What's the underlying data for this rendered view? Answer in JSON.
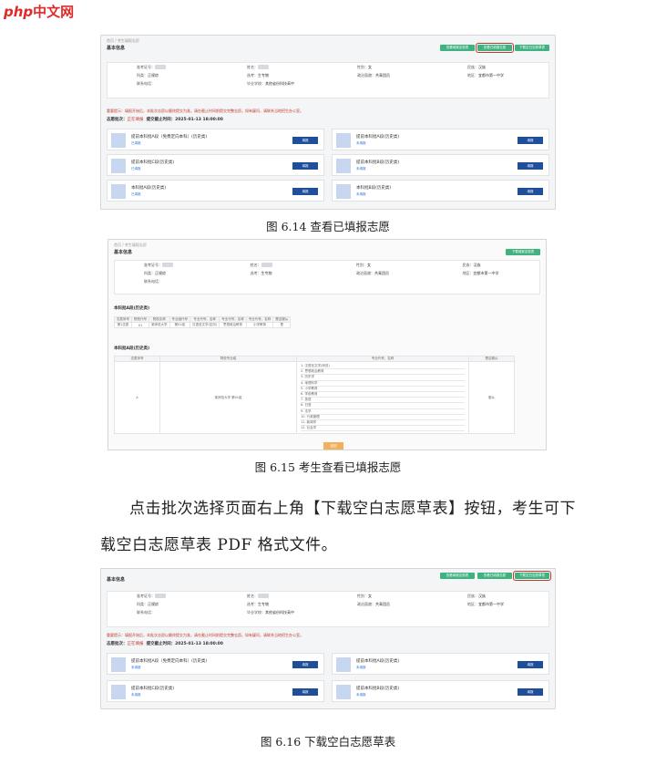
{
  "logo": {
    "php": "php",
    "cn": "中文网"
  },
  "common": {
    "crumb": "首页  /  考生填报志愿",
    "section_title": "基本信息",
    "labels": {
      "exam_no": "准考证号：",
      "name": "姓名：",
      "gender": "性别：",
      "nation": "民族：",
      "category": "科类：",
      "subject": "选考：",
      "political": "政治面貌：",
      "region": "地区：",
      "school": "毕业学校：",
      "phone": "联系电话："
    },
    "values": {
      "category": "正规综",
      "subject": "生专物",
      "gender": "女",
      "nation": "汉族",
      "political": "共青团员",
      "region": "宜都市第一中学",
      "school": "其他省份科技高中"
    },
    "top_buttons": [
      "查看填报志愿表",
      "查看已填报志愿",
      "下载空白志愿草表"
    ],
    "notice": "重要提示：填报开始后，本批次志愿以最终提交为准，请在截止时间前提交完整志愿。如有疑问，请联系当地招生办公室。",
    "batch": "志愿批次：",
    "batch_status": "正在填报",
    "deadline": "提交截止时间：2025-01-13 18:00:00",
    "card_button": "填报"
  },
  "figure1": {
    "caption": "图 6.14  查看已填报志愿",
    "cards": [
      {
        "name": "提前本科批A段（免费定向本科）(历史类)",
        "status": "已填报"
      },
      {
        "name": "提前本科批A段(历史类)",
        "status": "未填报"
      },
      {
        "name": "提前本科批C段(历史类)",
        "status": "已填报"
      },
      {
        "name": "提前本科批B段(历史类)",
        "status": "未填报"
      },
      {
        "name": "本科批A段(历史类)",
        "status": "已填报"
      },
      {
        "name": "本科批B段(历史类)",
        "status": "未填报"
      }
    ]
  },
  "figure2": {
    "caption": "图 6.15  考生查看已填报志愿",
    "top_button": "下载填报志愿表",
    "table1_title": "提前本科批A段（免费定向本科）(历史类)",
    "table1_headers": [
      "志愿序号",
      "院校代号",
      "院校名称",
      "专业组代号",
      "专业代号、名称",
      "专业代号、名称",
      "专业代号、名称",
      "是否服从"
    ],
    "table1_row": [
      "第1志愿",
      "01",
      "某师范大学",
      "第01组",
      "汉语言文学(定向)",
      "思想政治教育",
      "小学教育",
      "是"
    ],
    "table2_title": "本科批A段(历史类)",
    "table2_headers": [
      "志愿序号",
      "院校专业组",
      "专业代号、名称",
      "是否服从"
    ],
    "table2_row_no": "A",
    "table2_row_group": "某师范大学 第01组",
    "table2_row_obey": "服从",
    "choices": [
      "1. 汉语言文学(师范)",
      "2. 思想政治教育",
      "3. 历史学",
      "4. 地理科学",
      "5. 小学教育",
      "6. 学前教育",
      "7. 英语",
      "8. 日语",
      "9. 法学",
      "10. 行政管理",
      "11. 新闻学",
      "12. 社会学"
    ],
    "back_button": "返回"
  },
  "paragraph": {
    "line1": "点击批次选择页面右上角【下载空白志愿草表】按钮，考生可下",
    "line2": "载空白志愿草表 PDF 格式文件。"
  },
  "figure3": {
    "caption": "图 6.16  下载空白志愿草表",
    "cards": [
      {
        "name": "提前本科批A段（免费定向本科）(历史类)",
        "status": "未填报"
      },
      {
        "name": "提前本科批A段(历史类)",
        "status": "未填报"
      },
      {
        "name": "提前本科批C段(历史类)",
        "status": "未填报"
      },
      {
        "name": "提前本科批B段(历史类)",
        "status": "未填报"
      }
    ]
  },
  "colors": {
    "accent_green": "#3fb27f",
    "button_blue": "#1f4e9a",
    "highlight_red": "#c0392b",
    "back_orange": "#f3b05a"
  }
}
